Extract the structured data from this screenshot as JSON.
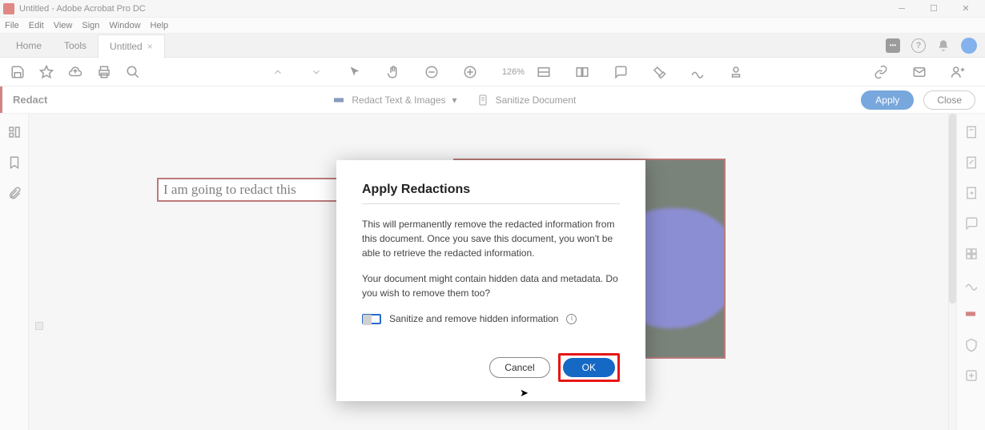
{
  "titlebar": {
    "title": "Untitled - Adobe Acrobat Pro DC"
  },
  "menubar": {
    "items": [
      "File",
      "Edit",
      "View",
      "Sign",
      "Window",
      "Help"
    ]
  },
  "tabs": {
    "home": "Home",
    "tools": "Tools",
    "doc": "Untitled",
    "close_glyph": "×"
  },
  "toolbar": {
    "zoom": "126%"
  },
  "redactbar": {
    "heading": "Redact",
    "opt1": "Redact Text & Images",
    "opt2": "Sanitize Document",
    "apply": "Apply",
    "close": "Close"
  },
  "canvas": {
    "redaction_text": "I am going to redact this"
  },
  "dialog": {
    "title": "Apply Redactions",
    "p1": "This will permanently remove the redacted information from this document. Once you save this document, you won't be able to retrieve the redacted information.",
    "p2": "Your document might contain hidden data and metadata. Do you wish to remove them too?",
    "check_label": "Sanitize and remove hidden information",
    "info_glyph": "i",
    "cancel": "Cancel",
    "ok": "OK"
  }
}
